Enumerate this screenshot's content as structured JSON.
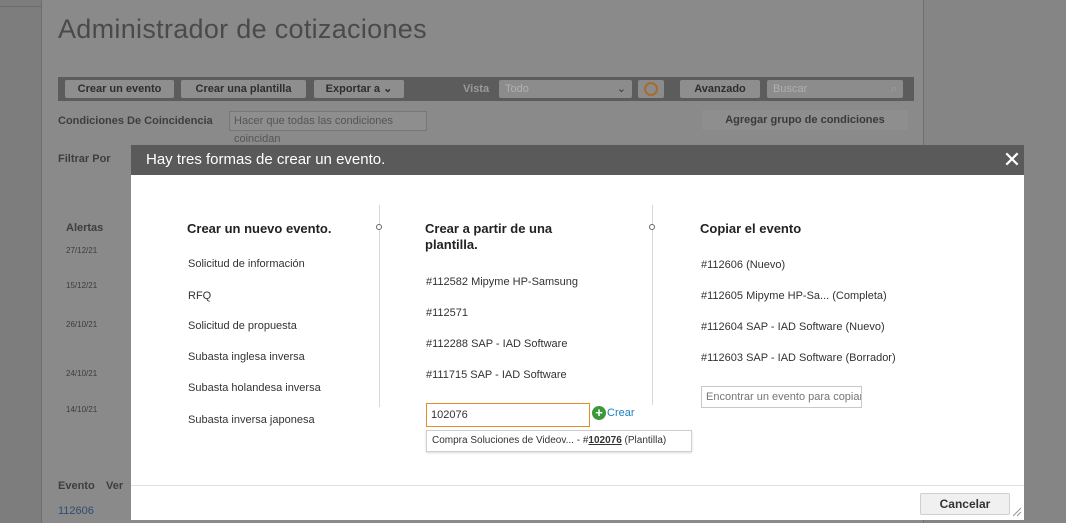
{
  "page": {
    "title": "Administrador de cotizaciones",
    "toolbar": {
      "create_event": "Crear un evento",
      "create_template": "Crear una plantilla",
      "export": "Exportar a",
      "view_label": "Vista",
      "view_value": "Todo",
      "advanced": "Avanzado",
      "search_placeholder": "Buscar"
    },
    "conditions_label": "Condiciones De Coincidencia",
    "conditions_value": "Hacer que todas las condiciones coincidan",
    "add_condition_group": "Agregar grupo de condiciones",
    "filter_label": "Filtrar Por",
    "alerts_label": "Alertas",
    "alert_dates": [
      "27/12/21",
      "15/12/21",
      "26/10/21",
      "24/10/21",
      "14/10/21"
    ],
    "event_col": "Evento",
    "event_col2": "Ver",
    "first_event": "112606"
  },
  "modal": {
    "title": "Hay tres formas de crear un evento.",
    "close_label": "✕",
    "new_event": {
      "heading": "Crear un nuevo evento.",
      "options": [
        "Solicitud de información",
        "RFQ",
        "Solicitud de propuesta",
        "Subasta inglesa inversa",
        "Subasta holandesa inversa",
        "Subasta inversa japonesa"
      ]
    },
    "from_template": {
      "heading": "Crear a partir de una plantilla.",
      "options": [
        "#112582 Mipyme HP-Samsung",
        "#112571",
        "#112288 SAP - IAD Software",
        "#111715 SAP - IAD Software"
      ],
      "input_value": "102076",
      "create_label": "Crear",
      "suggestion_prefix": "Compra Soluciones de Videov... - #",
      "suggestion_id": "102076",
      "suggestion_suffix": " (Plantilla)"
    },
    "copy_event": {
      "heading": "Copiar el evento",
      "options": [
        "#112606 (Nuevo)",
        "#112605 Mipyme HP-Sa... (Completa)",
        "#112604 SAP - IAD Software (Nuevo)",
        "#112603 SAP - IAD Software (Borrador)"
      ],
      "search_placeholder": "Encontrar un evento para copiar"
    },
    "cancel_label": "Cancelar"
  }
}
